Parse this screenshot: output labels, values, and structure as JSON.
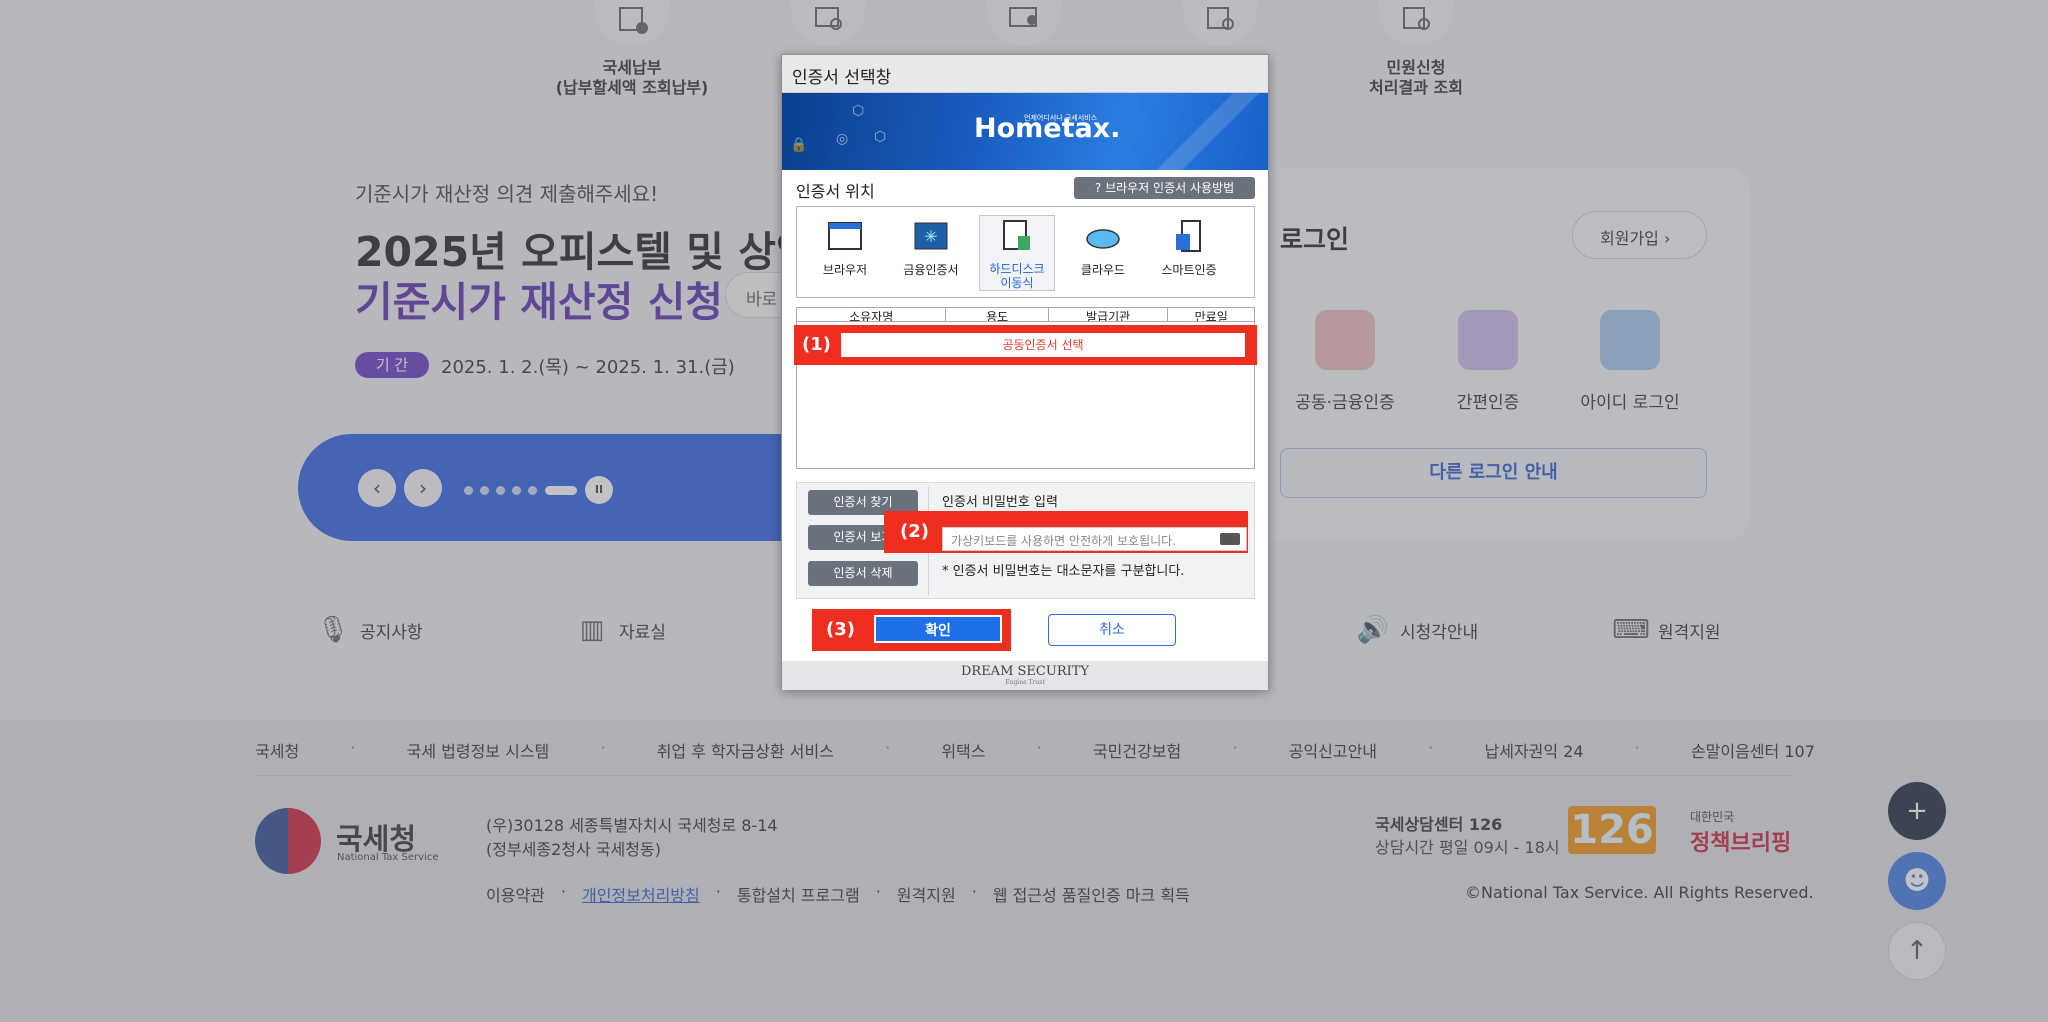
{
  "top_services": [
    {
      "line1": "국세납부",
      "line2": "(납부할세액 조회납부)"
    },
    {
      "line1": "민원신청",
      "line2": "처리결과 조회"
    }
  ],
  "promo": {
    "subtitle": "기준시가 재산정 의견 제출해주세요!",
    "title_line1": "2025년 오피스텔 및 상업",
    "title_line2": "기준시가 재산정 신청",
    "cta_partial": "바로",
    "period_badge": "기 간",
    "period_text": "2025. 1. 2.(목) ~ 2025. 1. 31.(금)"
  },
  "login": {
    "title": "로그인",
    "signup": "회원가입",
    "options": [
      "공동·금융인증",
      "간편인증",
      "아이디 로그인"
    ],
    "other": "다른 로그인 안내"
  },
  "quick_links": [
    "공지사항",
    "자료실",
    "시청각안내",
    "원격지원"
  ],
  "footer": {
    "links": [
      "국세청",
      "국세 법령정보 시스템",
      "취업 후 학자금상환 서비스",
      "위택스",
      "국민건강보험",
      "공익신고안내",
      "납세자권익 24",
      "손말이음센터 107"
    ],
    "org_name": "국세청",
    "org_eng": "National Tax Service",
    "address1": "(우)30128 세종특별자치시 국세청로 8-14",
    "address2": "(정부세종2청사 국세청동)",
    "links2": [
      "이용약관",
      "개인정보처리방침",
      "통합설치 프로그램",
      "원격지원",
      "웹 접근성 품질인증 마크 획득"
    ],
    "center_title": "국세상담센터 126",
    "center_hours": "상담시간 평일 09시 - 18시",
    "num": "126",
    "policy_small": "대한민국",
    "policy_big": "정책브리핑",
    "copyright": "©National Tax Service. All Rights Reserved."
  },
  "dialog": {
    "title": "인증서 선택창",
    "brand": "Hometax.",
    "brand_sub": "언제어디서나 국세서비스",
    "location_label": "인증서 위치",
    "help_button": "브라우저 인증서 사용방법",
    "locations": [
      {
        "label": "브라우저",
        "selected": false
      },
      {
        "label": "금융인증서",
        "selected": false
      },
      {
        "label": "하드디스크\n이동식",
        "selected": true
      },
      {
        "label": "클라우드",
        "selected": false
      },
      {
        "label": "스마트인증",
        "selected": false
      }
    ],
    "table_headers": [
      "소유자명",
      "용도",
      "발급기관",
      "만료일"
    ],
    "table_row": "공동인증서 선택",
    "buttons": [
      "인증서 찾기",
      "인증서 보기",
      "인증서 삭제"
    ],
    "password_label": "인증서 비밀번호 입력",
    "password_placeholder": "가상키보드를 사용하면 안전하게 보호됩니다.",
    "password_note": "* 인증서 비밀번호는 대소문자를 구분합니다.",
    "confirm": "확인",
    "cancel": "취소",
    "footer_brand": "DREAM SECURITY",
    "footer_tag": "Engine Trust"
  },
  "annotations": [
    "(1)",
    "(2)",
    "(3)"
  ],
  "colors": {
    "highlight": "#ee2e1f",
    "confirm": "#1f6fe8",
    "brand_blue": "#1d55e0"
  }
}
